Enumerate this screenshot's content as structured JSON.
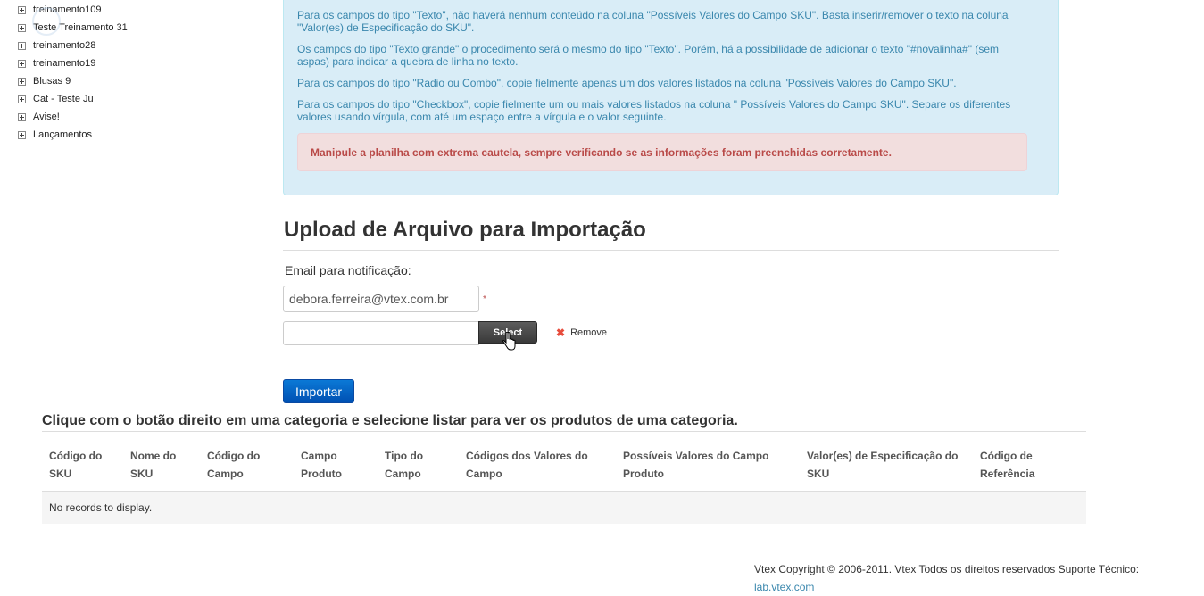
{
  "sidebar": {
    "items": [
      {
        "label": "treinamento109"
      },
      {
        "label": "Teste Treinamento 31"
      },
      {
        "label": "treinamento28"
      },
      {
        "label": "treinamento19"
      },
      {
        "label": "Blusas 9"
      },
      {
        "label": "Cat - Teste Ju"
      },
      {
        "label": "Avise!"
      },
      {
        "label": "Lançamentos"
      }
    ]
  },
  "info": {
    "p1": "Para os campos do tipo \"Texto\", não haverá nenhum conteúdo na coluna \"Possíveis Valores do Campo SKU\". Basta inserir/remover o texto na coluna \"Valor(es) de Especificação do SKU\".",
    "p2": "Os campos do tipo \"Texto grande\" o procedimento será o mesmo do tipo \"Texto\". Porém, há a possibilidade de adicionar o texto \"#novalinha#\" (sem aspas) para indicar a quebra de linha no texto.",
    "p3": "Para os campos do tipo \"Radio ou Combo\", copie fielmente apenas um dos valores listados na coluna \"Possíveis Valores do Campo SKU\".",
    "p4": "Para os campos do tipo \"Checkbox\", copie fielmente um ou mais valores listados na coluna \" Possíveis Valores do Campo SKU\". Separe os diferentes valores usando vírgula, com até um espaço entre a vírgula e o valor seguinte.",
    "warning": "Manipule a planilha com extrema cautela, sempre verificando se as informações foram preenchidas corretamente."
  },
  "upload": {
    "title": "Upload de Arquivo para Importação",
    "email_label": "Email para notificação:",
    "email_value": "debora.ferreira@vtex.com.br",
    "required_mark": "*",
    "select_label": "Select",
    "remove_label": "Remove",
    "import_label": "Importar"
  },
  "listing": {
    "title": "Clique com o botão direito em uma categoria e selecione listar para ver os produtos de uma categoria.",
    "columns": [
      "Código do SKU",
      "Nome do SKU",
      "Código do Campo",
      "Campo Produto",
      "Tipo do Campo",
      "Códigos dos Valores do Campo",
      "Possíveis Valores do Campo Produto",
      "Valor(es) de Especificação do SKU",
      "Código de Referência"
    ],
    "empty_text": "No records to display."
  },
  "footer": {
    "text": "Vtex Copyright © 2006-2011. Vtex Todos os direitos reservados Suporte Técnico:",
    "link": "lab.vtex.com"
  },
  "colors": {
    "info_bg": "#d9edf7",
    "info_text": "#3a87ad",
    "alert_bg": "#f2dede",
    "alert_text": "#b94a48",
    "primary_button": "#0b6fd0"
  }
}
